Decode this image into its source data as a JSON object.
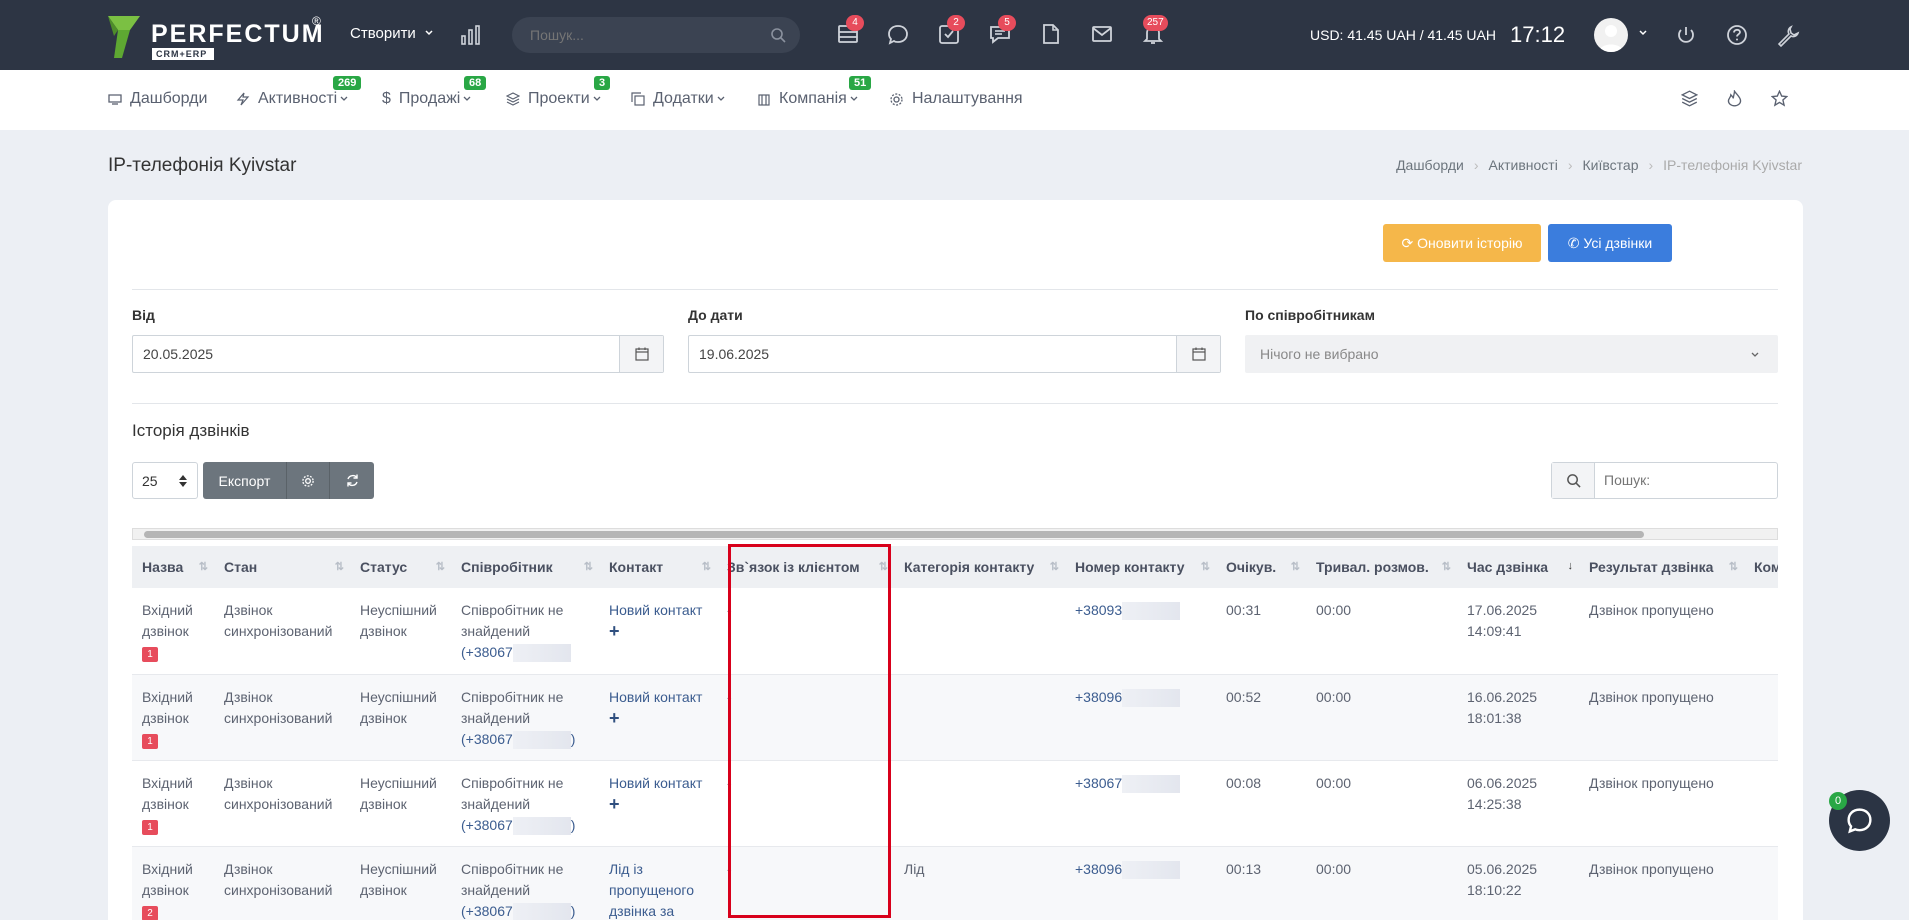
{
  "topbar": {
    "logo_text": "PERFECTUM",
    "logo_sub": "CRM+ERP",
    "create_label": "Створити",
    "search_placeholder": "Пошук...",
    "badges": {
      "cabinet": "4",
      "tasks": "2",
      "chat": "5",
      "notifications": "257"
    },
    "currency": "USD: 41.45 UAH / 41.45 UAH",
    "time": "17:12"
  },
  "nav": {
    "items": [
      {
        "label": "Дашборди"
      },
      {
        "label": "Активності",
        "badge": "269"
      },
      {
        "label": "Продажі",
        "badge": "68"
      },
      {
        "label": "Проекти",
        "badge": "3"
      },
      {
        "label": "Додатки"
      },
      {
        "label": "Компанія",
        "badge": "51"
      },
      {
        "label": "Налаштування"
      }
    ]
  },
  "page": {
    "title": "IP-телефонія Kyivstar",
    "breadcrumb": [
      "Дашборди",
      "Активності",
      "Київстар",
      "IP-телефонія Kyivstar"
    ]
  },
  "actions": {
    "refresh": "Оновити історію",
    "all_calls": "Усі дзвінки"
  },
  "filters": {
    "from_label": "Від",
    "from_value": "20.05.2025",
    "to_label": "До дати",
    "to_value": "19.06.2025",
    "employees_label": "По співробітникам",
    "employees_value": "Нічого не вибрано"
  },
  "history": {
    "title": "Історія дзвінків",
    "page_length": "25",
    "export_label": "Експорт",
    "search_placeholder": "Пошук:"
  },
  "table": {
    "columns": [
      "Назва",
      "Стан",
      "Статус",
      "Співробітник",
      "Контакт",
      "Зв`язок із клієнтом",
      "Категорія контакту",
      "Номер контакту",
      "Очікув.",
      "Тривал. розмов.",
      "Час дзвінка",
      "Результат дзвінка",
      "Ком"
    ],
    "rows": [
      {
        "name": "Вхідний дзвінок",
        "badge": "1",
        "state": "Дзвінок синхронізований",
        "status": "Неуспішний дзвінок",
        "employee": "Співробітник не знайдений",
        "employee_phone": "(+38067",
        "employee_phone_end": "",
        "contact": "Новий контакт",
        "relation": "-",
        "category": "",
        "number": "+38093",
        "wait": "00:31",
        "duration": "00:00",
        "date": "17.06.2025",
        "time": "14:09:41",
        "result": "Дзвінок пропущено"
      },
      {
        "name": "Вхідний дзвінок",
        "badge": "1",
        "state": "Дзвінок синхронізований",
        "status": "Неуспішний дзвінок",
        "employee": "Співробітник не знайдений",
        "employee_phone": "(+38067",
        "employee_phone_end": ")",
        "contact": "Новий контакт",
        "relation": "-",
        "category": "",
        "number": "+38096",
        "wait": "00:52",
        "duration": "00:00",
        "date": "16.06.2025",
        "time": "18:01:38",
        "result": "Дзвінок пропущено"
      },
      {
        "name": "Вхідний дзвінок",
        "badge": "1",
        "state": "Дзвінок синхронізований",
        "status": "Неуспішний дзвінок",
        "employee": "Співробітник не знайдений",
        "employee_phone": "(+38067",
        "employee_phone_end": ")",
        "contact": "Новий контакт",
        "relation": "-",
        "category": "",
        "number": "+38067",
        "wait": "00:08",
        "duration": "00:00",
        "date": "06.06.2025",
        "time": "14:25:38",
        "result": "Дзвінок пропущено"
      },
      {
        "name": "Вхідний дзвінок",
        "badge": "2",
        "state": "Дзвінок синхронізований",
        "status": "Неуспішний дзвінок",
        "employee": "Співробітник не знайдений",
        "employee_phone": "(+38067",
        "employee_phone_end": ")",
        "contact": "Лід із пропущеного дзвінка за",
        "relation": "-",
        "category": "Лід",
        "number": "+38096",
        "wait": "00:13",
        "duration": "00:00",
        "date": "05.06.2025",
        "time": "18:10:22",
        "result": "Дзвінок пропущено"
      }
    ]
  },
  "chat": {
    "badge": "0"
  },
  "colors": {
    "topbar": "#2d3544",
    "accent_blue": "#3b7ddd",
    "accent_orange": "#f5b74a",
    "badge_red": "#e74c5c",
    "badge_green": "#29a745",
    "highlight": "#d8001b"
  }
}
